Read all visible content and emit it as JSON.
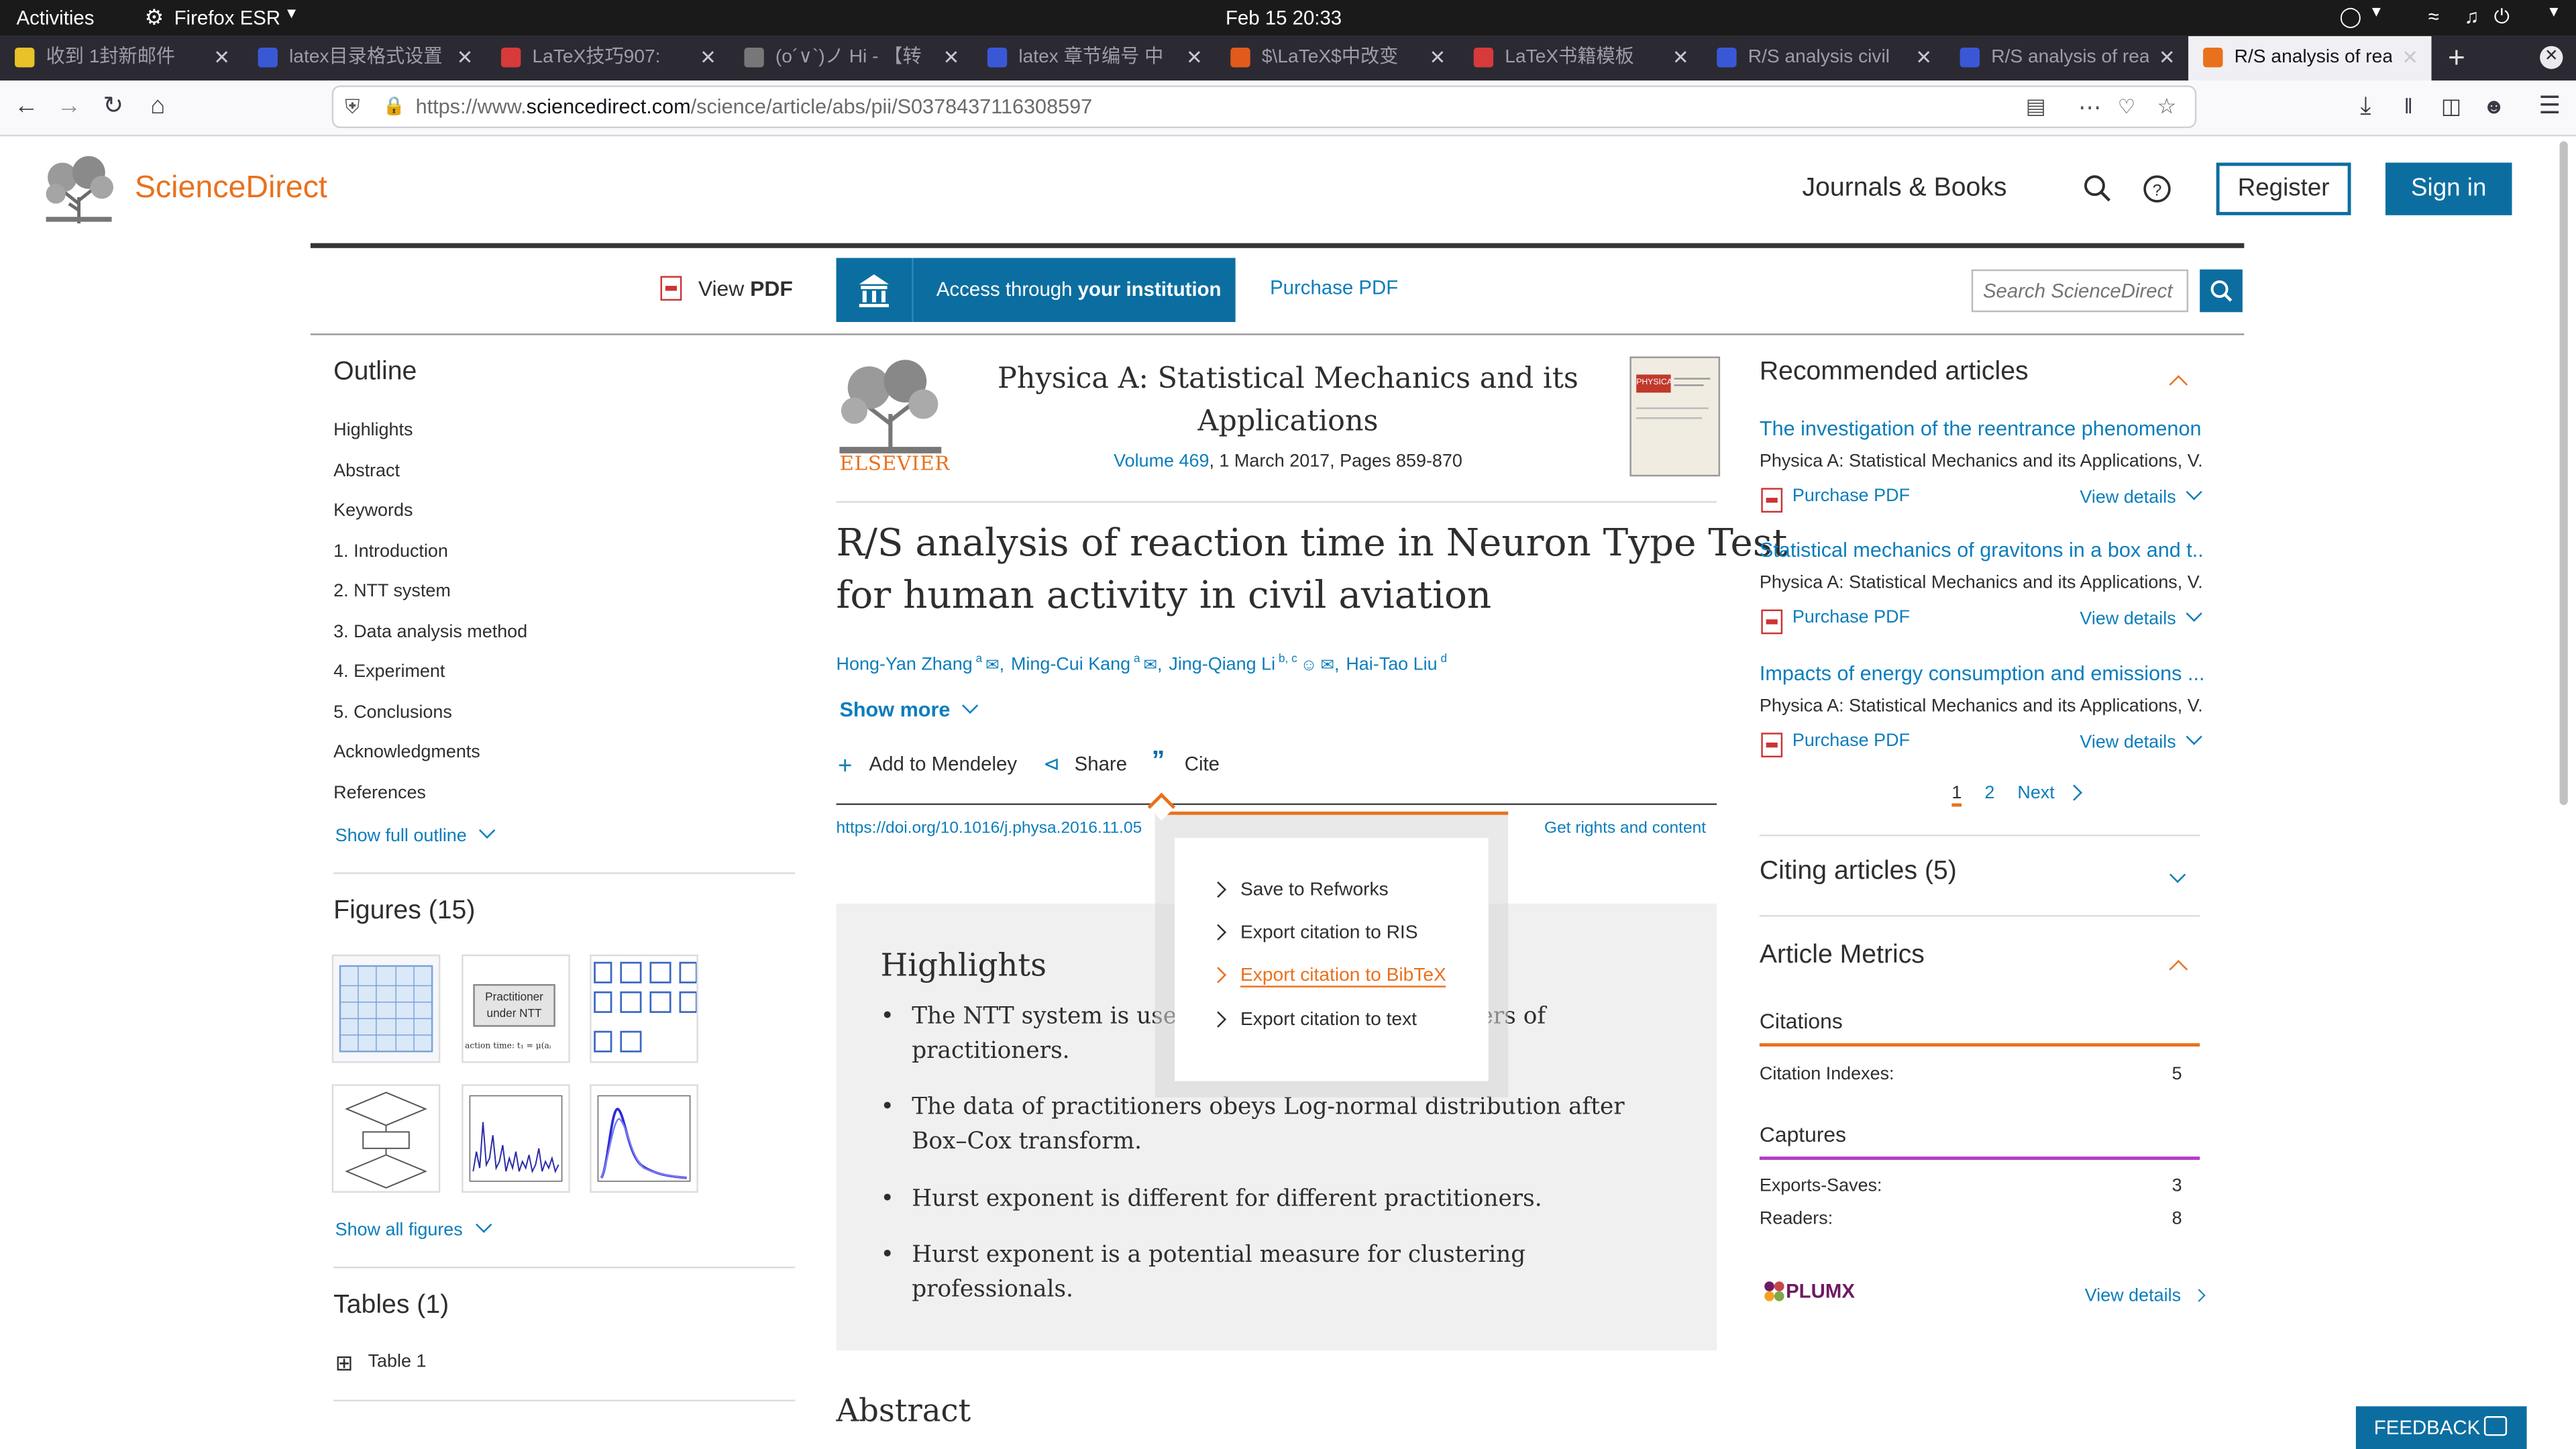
{
  "system_bar": {
    "activities": "Activities",
    "app": "Firefox ESR",
    "clock": "Feb 15  20:33"
  },
  "browser": {
    "tabs": [
      {
        "title": "收到 1封新邮件",
        "color": "#e8c228"
      },
      {
        "title": "latex目录格式设置",
        "color": "#3a58d6"
      },
      {
        "title": "LaTeX技巧907:",
        "color": "#d63a3a"
      },
      {
        "title": "(ο´∨`)ノ Hi - 【转",
        "color": "#777777"
      },
      {
        "title": "latex 章节编号 中",
        "color": "#3a58d6"
      },
      {
        "title": "$\\LaTeX$中改变",
        "color": "#e25a1c"
      },
      {
        "title": "LaTeX书籍模板",
        "color": "#d63a3a"
      },
      {
        "title": "R/S analysis civil",
        "color": "#3a58d6"
      },
      {
        "title": "R/S analysis of rea",
        "color": "#3a58d6"
      },
      {
        "title": "R/S analysis of rea",
        "color": "#e9711c"
      }
    ],
    "url_prefix": "https://www.",
    "url_domain": "sciencedirect.com",
    "url_path": "/science/article/abs/pii/S0378437116308597"
  },
  "header": {
    "brand": "ScienceDirect",
    "journals_books": "Journals & Books",
    "register": "Register",
    "signin": "Sign in"
  },
  "toolbar": {
    "view": "View",
    "pdf": "PDF",
    "access_prefix": "Access through ",
    "access_bold": "your institution",
    "purchase": "Purchase PDF",
    "search_placeholder": "Search ScienceDirect"
  },
  "outline": {
    "title": "Outline",
    "items": [
      "Highlights",
      "Abstract",
      "Keywords",
      "1. Introduction",
      "2. NTT system",
      "3. Data analysis method",
      "4. Experiment",
      "5. Conclusions",
      "Acknowledgments",
      "References"
    ],
    "show_full": "Show full outline",
    "figures_title": "Figures (15)",
    "fig_label": "Practitioner under NTT",
    "fig_formula": "action time: t₁ = μ(aᵢ",
    "show_figures": "Show all figures",
    "tables_title": "Tables (1)",
    "table1": "Table 1"
  },
  "article": {
    "publisher": "ELSEVIER",
    "journal_line1": "Physica A: Statistical Mechanics and its",
    "journal_line2": "Applications",
    "volume": "Volume 469",
    "volume_rest": ", 1 March 2017, Pages 859-870",
    "cover_label": "PHYSICA",
    "title_line1": "R/S analysis of reaction time in Neuron Type Test",
    "title_line2": "for human activity in civil aviation",
    "authors": [
      {
        "name": "Hong-Yan Zhang",
        "sup": "a",
        "sep": ","
      },
      {
        "name": "Ming-Cui Kang",
        "sup": "a",
        "sep": ","
      },
      {
        "name": "Jing-Qiang Li",
        "sup": "b, c",
        "sep": ","
      },
      {
        "name": "Hai-Tao Liu",
        "sup": "d",
        "sep": ""
      }
    ],
    "show_more": "Show more",
    "mendeley": "Add to Mendeley",
    "share": "Share",
    "cite": "Cite",
    "doi": "https://doi.org/10.1016/j.physa.2016.11.05",
    "rights": "Get rights and content",
    "highlights_title": "Highlights",
    "highlights": [
      "The NTT system is used to measure the parameters of practitioners.",
      "The data of practitioners obeys Log-normal distribution after Box–Cox transform.",
      "Hurst exponent is different for different practitioners.",
      "Hurst exponent is a potential measure for clustering professionals."
    ],
    "abstract_title": "Abstract"
  },
  "cite_menu": {
    "items": [
      "Save to Refworks",
      "Export citation to RIS",
      "Export citation to BibTeX",
      "Export citation to text"
    ],
    "highlight_index": 2
  },
  "recommended": {
    "title": "Recommended articles",
    "articles": [
      {
        "title": "The investigation of the reentrance phenomenon...",
        "journal": "Physica A: Statistical Mechanics and its Applications, V..."
      },
      {
        "title": "Statistical mechanics of gravitons in a box and t...",
        "journal": "Physica A: Statistical Mechanics and its Applications, V..."
      },
      {
        "title": "Impacts of energy consumption and emissions ...",
        "journal": "Physica A: Statistical Mechanics and its Applications, V..."
      }
    ],
    "purchase": "Purchase PDF",
    "view_details": "View details",
    "page1": "1",
    "page2": "2",
    "next": "Next"
  },
  "citing": {
    "title": "Citing articles (5)"
  },
  "metrics": {
    "title": "Article Metrics",
    "citations": "Citations",
    "citation_indexes": "Citation Indexes:",
    "citation_indexes_val": "5",
    "captures": "Captures",
    "exports_saves": "Exports-Saves:",
    "exports_saves_val": "3",
    "readers": "Readers:",
    "readers_val": "8",
    "plumx": "PLUMX",
    "view_details": "View details"
  },
  "feedback": "FEEDBACK",
  "colors": {
    "accent_orange": "#e9711c",
    "link_blue": "#0c7dbb",
    "brand_blue": "#0c6ea0",
    "captures_purple": "#b53bc8"
  }
}
